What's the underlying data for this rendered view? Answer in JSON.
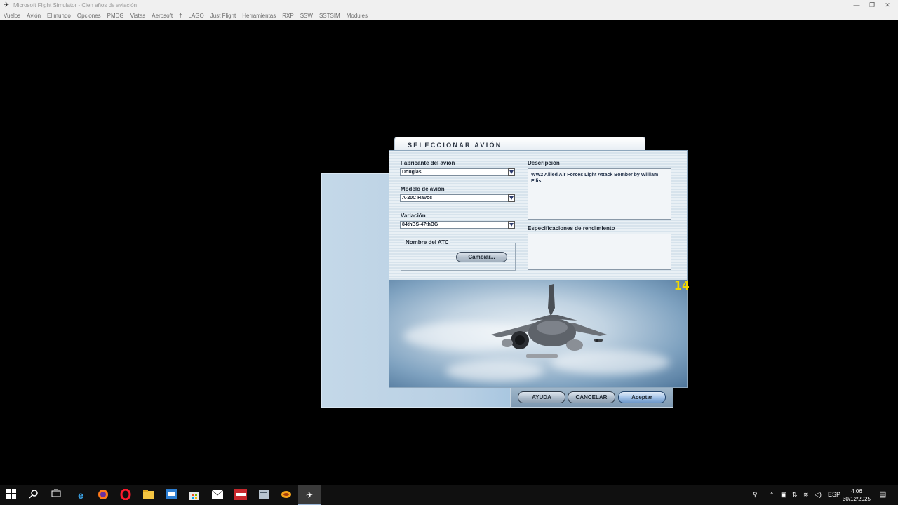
{
  "window": {
    "title": "Microsoft Flight Simulator - Cien años de aviación",
    "controls": [
      "minimize-icon",
      "restore-icon",
      "close-icon"
    ]
  },
  "menubar": {
    "items": [
      "Vuelos",
      "Avión",
      "El mundo",
      "Opciones",
      "PMDG",
      "Vistas",
      "Aerosoft",
      "†",
      "LAGO",
      "Just Flight",
      "Herramientas",
      "RXP",
      "SSW",
      "SSTSIM",
      "Modules"
    ]
  },
  "dialog": {
    "title": "SELECCIONAR AVIÓN",
    "manufacturer": {
      "label": "Fabricante del avión",
      "value": "Douglas"
    },
    "model": {
      "label": "Modelo de avión",
      "value": "A-20C Havoc"
    },
    "variation": {
      "label": "Variación",
      "value": "84thBS-47thBG"
    },
    "atc": {
      "label": "Nombre del ATC",
      "change_button": "Cambiar..."
    },
    "description": {
      "label": "Descripción",
      "text": "WW2 Allied Air Forces Light Attack Bomber by William Ellis"
    },
    "performance": {
      "label": "Especificaciones de rendimiento",
      "text": ""
    },
    "fps": "14",
    "buttons": {
      "help": "AYUDA",
      "cancel": "CANCELAR",
      "accept": "Aceptar"
    }
  },
  "taskbar": {
    "apps": [
      "windows-start-icon",
      "search-icon",
      "task-view-icon",
      "edge-icon",
      "firefox-icon",
      "opera-icon",
      "file-explorer-icon",
      "store-icon",
      "mail-icon",
      "app-icon",
      "app-icon",
      "app-icon",
      "flight-simulator-icon"
    ],
    "language": "ESP",
    "time": "4:06",
    "date": "30/12/2025"
  },
  "colors": {
    "dialog_bg": "#dfe8ef",
    "accent": "#6e98c9",
    "fps": "#f2d900"
  }
}
